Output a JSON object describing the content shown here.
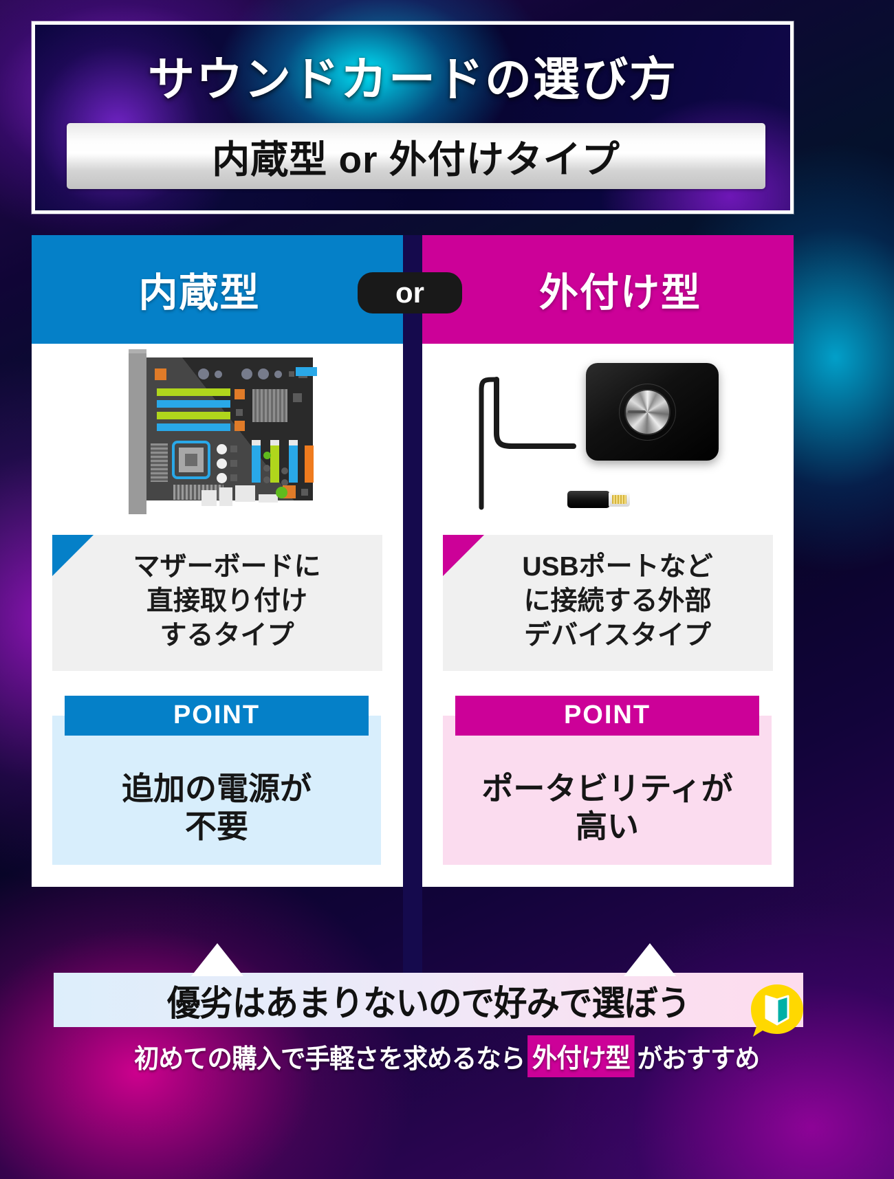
{
  "header": {
    "title": "サウンドカードの選び方",
    "subtitle": "内蔵型 or 外付けタイプ"
  },
  "or_badge": "or",
  "columns": [
    {
      "key": "internal",
      "heading": "内蔵型",
      "accent": "#0580c8",
      "point_bg": "#d8eefc",
      "image": "internal-sound-card-image",
      "description": "マザーボードに\n直接取り付け\nするタイプ",
      "description_lines": [
        "マザーボードに",
        "直接取り付け",
        "するタイプ"
      ],
      "point_label": "POINT",
      "point_text_lines": [
        "追加の電源が",
        "不要"
      ]
    },
    {
      "key": "external",
      "heading": "外付け型",
      "accent": "#cc0198",
      "point_bg": "#fbdcef",
      "image": "external-usb-dac-image",
      "description": "USBポートなど\nに接続する外部\nデバイスタイプ",
      "description_lines": [
        "USBポートなど",
        "に接続する外部",
        "デバイスタイプ"
      ],
      "point_label": "POINT",
      "point_text_lines": [
        "ポータビリティが",
        "高い"
      ]
    }
  ],
  "footer": {
    "banner": "優劣はあまりないので好みで選ぼう",
    "note_before": "初めての購入で手軽さを求めるなら",
    "note_highlight": "外付け型",
    "note_after": "がおすすめ",
    "highlight_color": "#cc0198",
    "icon": "book-speech-bubble-icon"
  }
}
